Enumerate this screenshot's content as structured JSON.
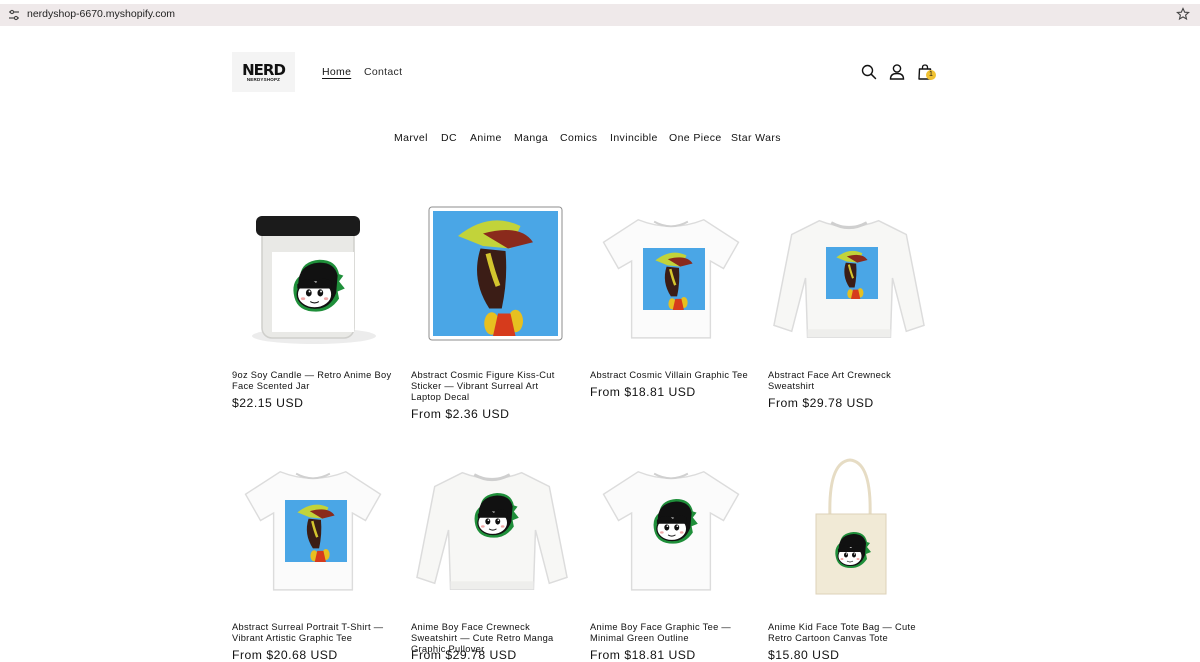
{
  "browser": {
    "url": "nerdyshop-6670.myshopify.com"
  },
  "header": {
    "logo_text": "NERD",
    "logo_subtext": "NERDYSHOPZ",
    "nav": [
      {
        "label": "Home",
        "active": true
      },
      {
        "label": "Contact",
        "active": false
      }
    ],
    "icons": [
      "search-icon",
      "account-icon",
      "cart-icon"
    ],
    "cart_count": "1"
  },
  "categories": [
    "Marvel",
    "DC",
    "Anime",
    "Manga",
    "Comics",
    "Invincible",
    "One Piece",
    "Star Wars"
  ],
  "products": [
    {
      "title": "9oz Soy Candle — Retro Anime Boy Face Scented Jar",
      "price": "$22.15 USD",
      "image": "candle-jar"
    },
    {
      "title": "Abstract Cosmic Figure Kiss-Cut Sticker — Vibrant Surreal Art Laptop Decal",
      "price": "From $2.36 USD",
      "image": "sticker"
    },
    {
      "title": "Abstract Cosmic Villain Graphic Tee",
      "price": "From $18.81 USD",
      "image": "tee-abstract"
    },
    {
      "title": "Abstract Face Art Crewneck Sweatshirt",
      "price": "From $29.78 USD",
      "image": "sweatshirt-abstract"
    },
    {
      "title": "Abstract Surreal Portrait T-Shirt — Vibrant Artistic Graphic Tee",
      "price": "From $20.68 USD",
      "image": "tee-abstract-cream"
    },
    {
      "title": "Anime Boy Face Crewneck Sweatshirt — Cute Retro Manga Graphic Pullover",
      "price": "From $29.78 USD",
      "image": "sweatshirt-anime"
    },
    {
      "title": "Anime Boy Face Graphic Tee — Minimal Green Outline",
      "price": "From $18.81 USD",
      "image": "tee-anime"
    },
    {
      "title": "Anime Kid Face Tote Bag — Cute Retro Cartoon Canvas Tote",
      "price": "$15.80 USD",
      "image": "tote-bag"
    }
  ],
  "colors": {
    "text": "#121212",
    "badge": "#f1c232",
    "urlbar_bg": "#efe9ea",
    "sky_blue": "#4aa6e6",
    "anime_green": "#1f8f3a"
  }
}
